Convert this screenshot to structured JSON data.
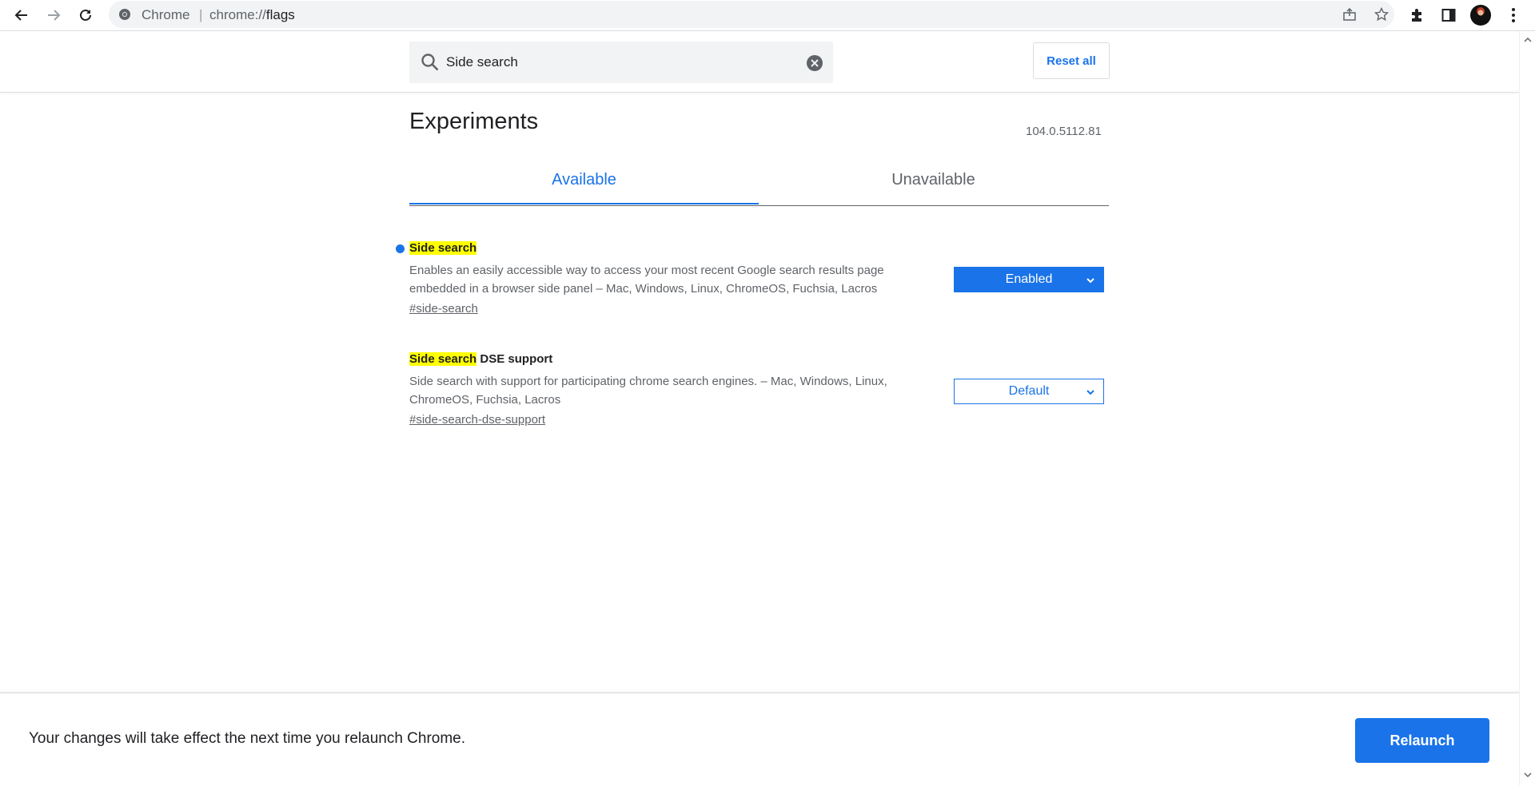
{
  "browser": {
    "site_label": "Chrome",
    "separator": "|",
    "url_scheme": "chrome://",
    "url_host": "flags",
    "icons": {
      "back": "arrow-left-icon",
      "forward": "arrow-right-icon",
      "reload": "reload-icon",
      "share": "share-icon",
      "bookmark": "star-icon",
      "extensions": "puzzle-icon",
      "side_panel": "side-panel-icon",
      "profile": "avatar",
      "menu": "kebab-menu-icon"
    }
  },
  "header": {
    "search_value": "Side search",
    "reset_label": "Reset all"
  },
  "page": {
    "title": "Experiments",
    "version": "104.0.5112.81",
    "tabs": [
      {
        "label": "Available",
        "active": true
      },
      {
        "label": "Unavailable",
        "active": false
      }
    ]
  },
  "experiments": [
    {
      "name_highlight": "Side search",
      "name_rest": "",
      "description": "Enables an easily accessible way to access your most recent Google search results page embedded in a browser side panel – Mac, Windows, Linux, ChromeOS, Fuchsia, Lacros",
      "link": "#side-search",
      "selected": "Enabled",
      "modified": true
    },
    {
      "name_highlight": "Side search",
      "name_rest": " DSE support",
      "description": "Side search with support for participating chrome search engines. – Mac, Windows, Linux, ChromeOS, Fuchsia, Lacros",
      "link": "#side-search-dse-support",
      "selected": "Default",
      "modified": false
    }
  ],
  "footer": {
    "message": "Your changes will take effect the next time you relaunch Chrome.",
    "relaunch_label": "Relaunch"
  },
  "colors": {
    "accent": "#1a73e8",
    "highlight": "#ffff00",
    "text": "#202124",
    "secondary_text": "#5f6368"
  }
}
